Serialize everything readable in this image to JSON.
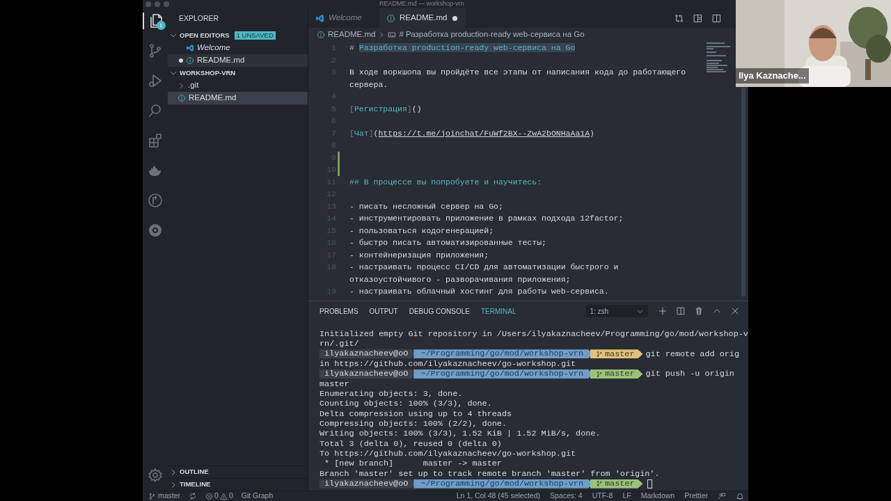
{
  "window": {
    "title": "README.md — workshop-vrn"
  },
  "activity_bar": {
    "items": [
      {
        "kind": "files",
        "selected": true,
        "badge": "1"
      },
      {
        "kind": "source-control",
        "selected": false
      },
      {
        "kind": "run",
        "selected": false
      },
      {
        "kind": "search",
        "selected": false
      },
      {
        "kind": "extensions",
        "selected": false
      },
      {
        "kind": "docker",
        "selected": false
      },
      {
        "kind": "remote",
        "selected": false
      },
      {
        "kind": "helm",
        "selected": false
      }
    ],
    "bottom": [
      {
        "kind": "settings"
      }
    ]
  },
  "sidebar": {
    "title": "EXPLORER",
    "sections": [
      {
        "title": "OPEN EDITORS",
        "expanded": true,
        "badge": "1 UNSAVED",
        "items": [
          {
            "label": "Welcome",
            "kind": "welcome",
            "preview": true,
            "unsaved": false,
            "selected": false
          },
          {
            "label": "README.md",
            "kind": "info",
            "preview": false,
            "unsaved": true,
            "selected": true
          }
        ]
      },
      {
        "title": "WORKSHOP-VRN",
        "expanded": true,
        "items": [
          {
            "label": ".git",
            "kind": "folder",
            "selected": false
          },
          {
            "label": "README.md",
            "kind": "info",
            "selected": true
          }
        ]
      }
    ],
    "bottom_sections": [
      {
        "title": "OUTLINE",
        "expanded": false
      },
      {
        "title": "TIMELINE",
        "expanded": false
      }
    ]
  },
  "tabs": [
    {
      "label": "Welcome",
      "kind": "welcome",
      "preview": true,
      "unsaved": false,
      "selected": false
    },
    {
      "label": "README.md",
      "kind": "info",
      "preview": false,
      "unsaved": true,
      "selected": true
    }
  ],
  "editor_actions": [
    {
      "kind": "compare"
    },
    {
      "kind": "preview"
    },
    {
      "kind": "split"
    }
  ],
  "breadcrumb": [
    {
      "label": "README.md",
      "kind": "info"
    },
    {
      "label": "# Разработка production-ready web-сервиса на Go",
      "kind": "heading"
    }
  ],
  "code_lines": [
    {
      "number": "1",
      "modified": false,
      "segments": [
        {
          "text": "# ",
          "kind": "mark"
        },
        {
          "text": "Разработка production-ready web-сервиса на Go",
          "kind": "heading",
          "highlighted": true
        }
      ]
    },
    {
      "number": "2",
      "modified": false
    },
    {
      "number": "3",
      "modified": false,
      "segments": [
        {
          "text": "В ходе воркшопа вы пройдёте все этапы от написания кода до работающего сервера.",
          "kind": "plain"
        }
      ]
    },
    {
      "number": "4",
      "modified": false
    },
    {
      "number": "5",
      "modified": false,
      "segments": [
        {
          "text": "[",
          "kind": "punct"
        },
        {
          "text": "Регистрация",
          "kind": "link-text"
        },
        {
          "text": "]",
          "kind": "punct"
        },
        {
          "text": "()",
          "kind": "plain"
        }
      ]
    },
    {
      "number": "6",
      "modified": false
    },
    {
      "number": "7",
      "modified": false,
      "segments": [
        {
          "text": "[",
          "kind": "punct"
        },
        {
          "text": "Чат",
          "kind": "link-text"
        },
        {
          "text": "]",
          "kind": "punct"
        },
        {
          "text": "(",
          "kind": "plain"
        },
        {
          "text": "https://t.me/joinchat/FuWf2BX--ZwA2bONHaAa1A",
          "kind": "url"
        },
        {
          "text": ")",
          "kind": "plain"
        }
      ]
    },
    {
      "number": "8",
      "modified": false
    },
    {
      "number": "9",
      "modified": true
    },
    {
      "number": "10",
      "modified": true
    },
    {
      "number": "11",
      "modified": false,
      "segments": [
        {
          "text": "## В процессе вы попробуете и научитесь:",
          "kind": "heading"
        }
      ]
    },
    {
      "number": "12",
      "modified": false
    },
    {
      "number": "13",
      "modified": false,
      "segments": [
        {
          "text": "- писать несложный сервер на Go;",
          "kind": "plain"
        }
      ]
    },
    {
      "number": "14",
      "modified": false,
      "segments": [
        {
          "text": "- инструментировать приложение в рамках подхода 12factor;",
          "kind": "plain"
        }
      ]
    },
    {
      "number": "15",
      "modified": false,
      "segments": [
        {
          "text": "- пользоваться кодогенерацией;",
          "kind": "plain"
        }
      ]
    },
    {
      "number": "16",
      "modified": false,
      "segments": [
        {
          "text": "- быстро писать автоматизированные тесты;",
          "kind": "plain"
        }
      ]
    },
    {
      "number": "17",
      "modified": false,
      "segments": [
        {
          "text": "- контейнеризация приложения;",
          "kind": "plain"
        }
      ]
    },
    {
      "number": "18",
      "modified": false,
      "segments": [
        {
          "text": "- настраивать процесс CI/CD для автоматизации быстрого и отказоустойчивого - разворачивания приложения;",
          "kind": "plain"
        }
      ]
    },
    {
      "number": "19",
      "modified": false,
      "segments": [
        {
          "text": "- настраивать облачный хостинг для работы web-сервиса.",
          "kind": "plain"
        }
      ]
    }
  ],
  "panel": {
    "tabs": [
      {
        "label": "PROBLEMS",
        "selected": false
      },
      {
        "label": "OUTPUT",
        "selected": false
      },
      {
        "label": "DEBUG CONSOLE",
        "selected": false
      },
      {
        "label": "TERMINAL",
        "selected": true
      }
    ],
    "terminal_select": "1: zsh",
    "actions": [
      {
        "kind": "add"
      },
      {
        "kind": "split"
      },
      {
        "kind": "trash"
      },
      {
        "kind": "maximize"
      },
      {
        "kind": "close"
      }
    ]
  },
  "terminal_rows": [
    {
      "kind": "text",
      "text": "Initialized empty Git repository in /Users/ilyakaznacheev/Programming/go/mod/workshop-v"
    },
    {
      "kind": "text",
      "text": "rn/.git/"
    },
    {
      "kind": "prompt",
      "user": "ilyakaznacheev@oO",
      "path": "~/Programming/go/mod/workshop-vrn",
      "branch": "master",
      "color": "#e5c07b",
      "command": "git remote add orig",
      "cursor": false
    },
    {
      "kind": "text",
      "text": "in https://github.com/ilyakaznacheev/go-workshop.git"
    },
    {
      "kind": "prompt",
      "user": "ilyakaznacheev@oO",
      "path": "~/Programming/go/mod/workshop-vrn",
      "branch": "master",
      "color": "#98c379",
      "command": "git push -u origin",
      "cursor": false
    },
    {
      "kind": "text",
      "text": "master"
    },
    {
      "kind": "text",
      "text": "Enumerating objects: 3, done."
    },
    {
      "kind": "text",
      "text": "Counting objects: 100% (3/3), done."
    },
    {
      "kind": "text",
      "text": "Delta compression using up to 4 threads"
    },
    {
      "kind": "text",
      "text": "Compressing objects: 100% (2/2), done."
    },
    {
      "kind": "text",
      "text": "Writing objects: 100% (3/3), 1.52 KiB | 1.52 MiB/s, done."
    },
    {
      "kind": "text",
      "text": "Total 3 (delta 0), reused 0 (delta 0)"
    },
    {
      "kind": "text",
      "text": "To https://github.com/ilyakaznacheev/go-workshop.git"
    },
    {
      "kind": "text",
      "text": " * [new branch]      master -> master"
    },
    {
      "kind": "text",
      "text": "Branch 'master' set up to track remote branch 'master' from 'origin'."
    },
    {
      "kind": "prompt",
      "user": "ilyakaznacheev@oO",
      "path": "~/Programming/go/mod/workshop-vrn",
      "branch": "master",
      "color": "#98c379",
      "cursor": true
    }
  ],
  "status_bar": {
    "left": [
      {
        "kind": "branch",
        "text": "master"
      },
      {
        "kind": "sync"
      },
      {
        "kind": "problems",
        "errors": "0",
        "warnings": "0"
      },
      {
        "kind": "text",
        "text": "Git Graph"
      }
    ],
    "right": [
      {
        "kind": "text",
        "text": "Ln 1, Col 48 (45 selected)"
      },
      {
        "kind": "text",
        "text": "Spaces: 4"
      },
      {
        "kind": "text",
        "text": "UTF-8"
      },
      {
        "kind": "text",
        "text": "LF"
      },
      {
        "kind": "text",
        "text": "Markdown"
      },
      {
        "kind": "text",
        "text": "Prettier"
      },
      {
        "kind": "feedback"
      },
      {
        "kind": "bell"
      }
    ]
  },
  "webcam": {
    "name": "Ilya Kaznache..."
  }
}
